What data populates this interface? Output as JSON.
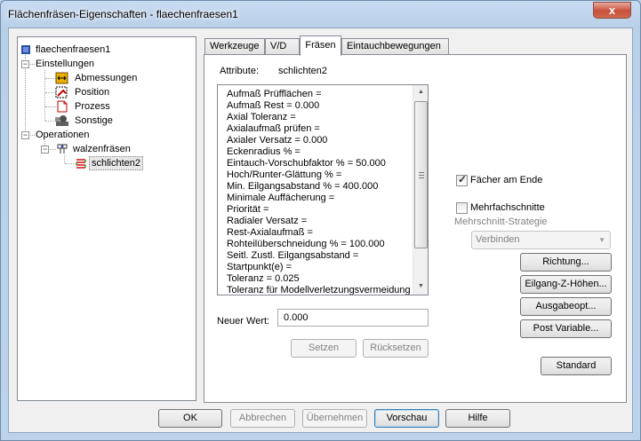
{
  "window": {
    "title": "Flächenfräsen-Eigenschaften - flaechenfraesen1",
    "close_label": "x"
  },
  "tree": {
    "root": "flaechenfraesen1",
    "settings": "Einstellungen",
    "settings_children": [
      "Abmessungen",
      "Position",
      "Prozess",
      "Sonstige"
    ],
    "operations": "Operationen",
    "operation": "walzenfräsen",
    "sub_operation": "schlichten2"
  },
  "tabs": [
    "Werkzeuge",
    "V/D",
    "Fräsen",
    "Eintauchbewegungen"
  ],
  "active_tab": "Fräsen",
  "panel": {
    "attr_label": "Attribute:",
    "attr_value": "schlichten2",
    "attributes": [
      "Aufmaß Prüfflächen =",
      "Aufmaß Rest = 0.000",
      "Axial Toleranz =",
      "Axialaufmaß prüfen =",
      "Axialer Versatz = 0.000",
      "Eckenradius % =",
      "Eintauch-Vorschubfaktor % = 50.000",
      "Hoch/Runter-Glättung % =",
      "Min. Eilgangsabstand % = 400.000",
      "Minimale Auffächerung =",
      "Priorität =",
      "Radialer Versatz =",
      "Rest-Axialaufmaß =",
      "Rohteilüberschneidung % = 100.000",
      "Seitl. Zustl. Eilgangsabstand =",
      "Startpunkt(e) =",
      "Toleranz = 0.025",
      "Toleranz für Modellverletzungsvermeidung"
    ],
    "new_value_label": "Neuer Wert:",
    "new_value": "0.000",
    "set_button": "Setzen",
    "reset_button": "Rücksetzen",
    "fan_checkbox": "Fächer am Ende",
    "fan_checked": true,
    "multi_checkbox": "Mehrfachschnitte",
    "multi_checked": false,
    "multi_strategy_label": "Mehrschnitt-Strategie",
    "multi_strategy_value": "Verbinden",
    "direction_button": "Richtung...",
    "rapid_z_button": "Eilgang-Z-Höhen...",
    "output_button": "Ausgabeopt...",
    "post_button": "Post Variable...",
    "standard_button": "Standard"
  },
  "footer": {
    "ok": "OK",
    "cancel": "Abbrechen",
    "apply": "Übernehmen",
    "preview": "Vorschau",
    "help": "Hilfe"
  }
}
